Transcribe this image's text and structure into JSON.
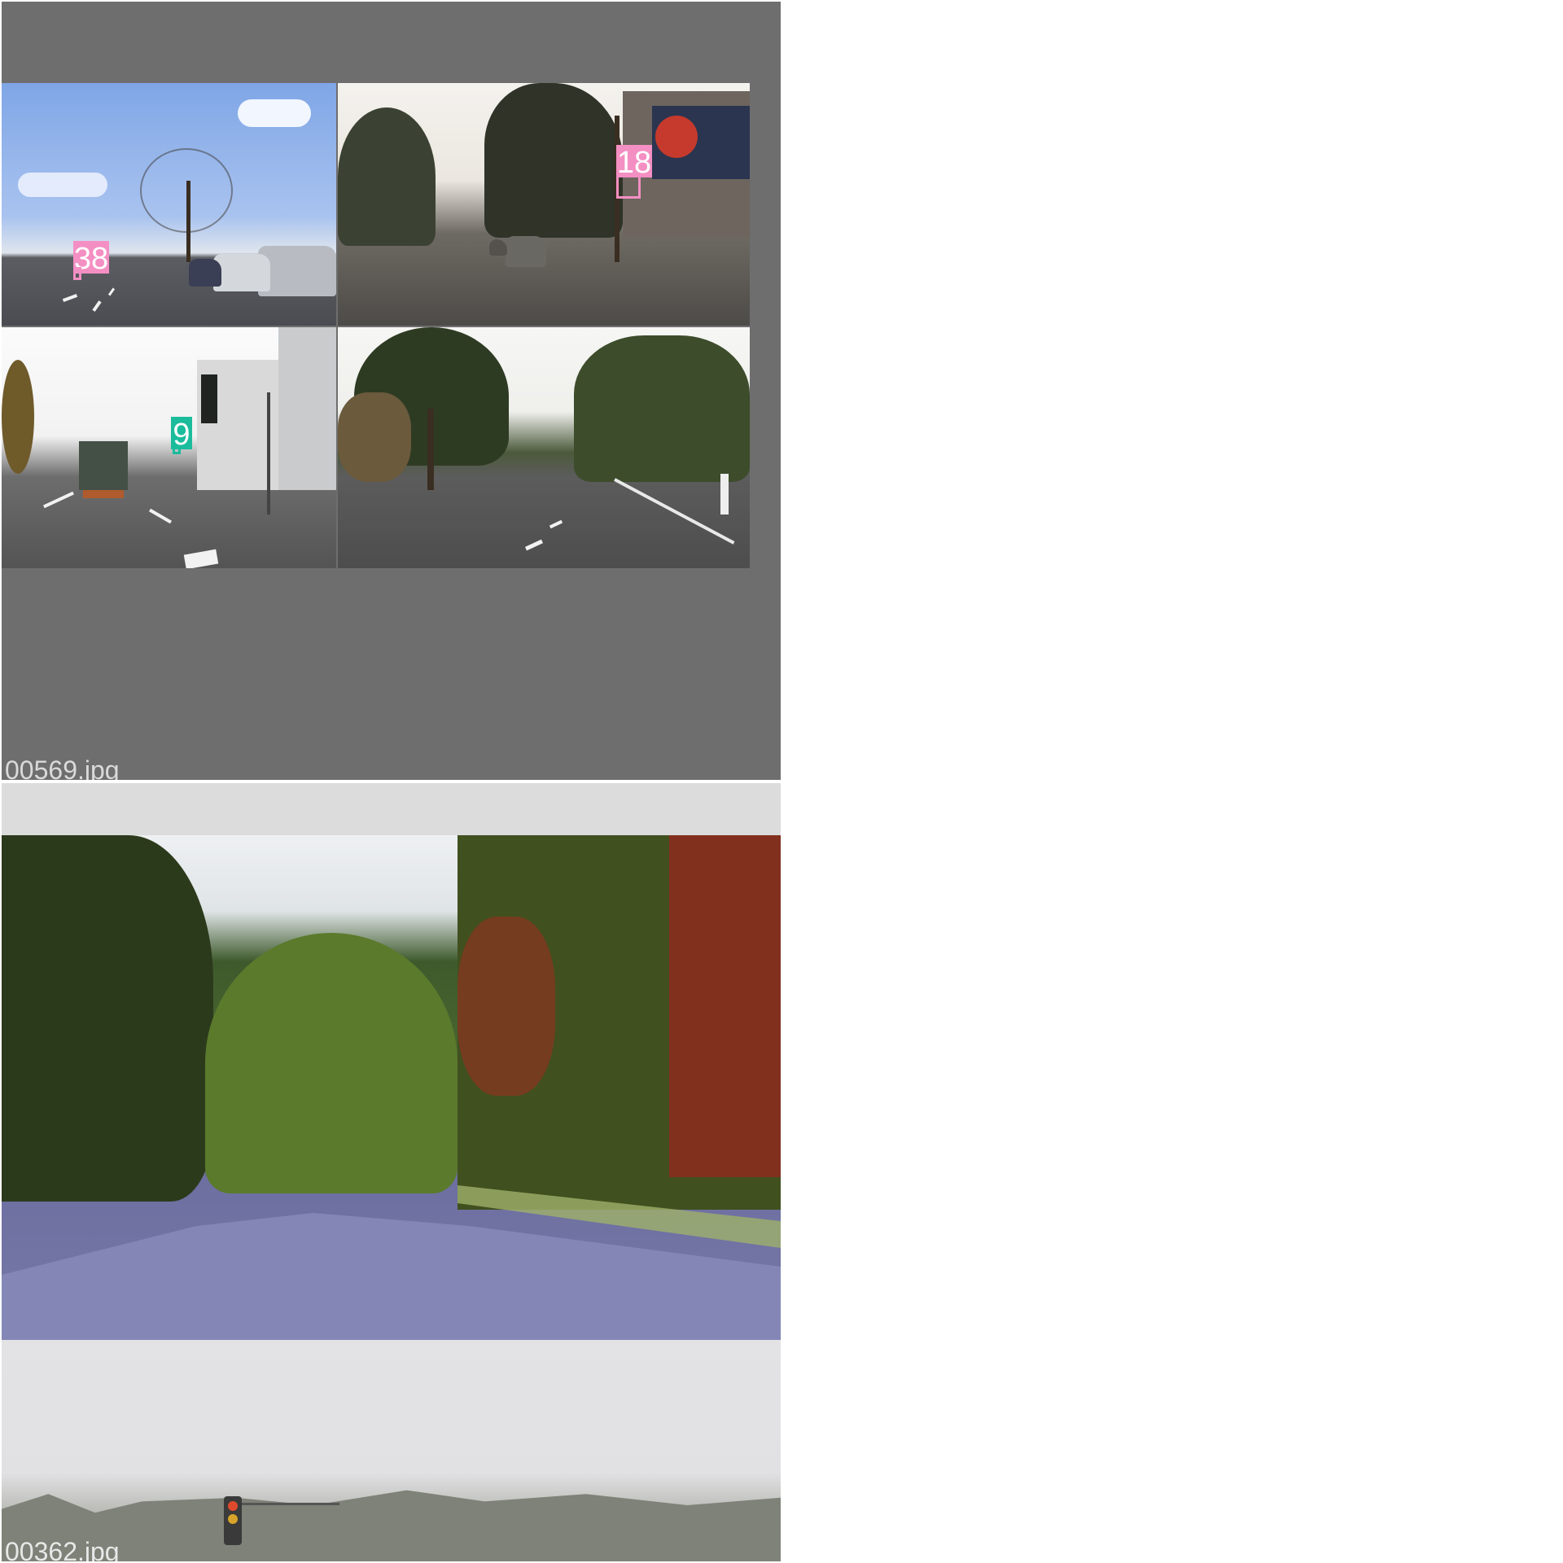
{
  "tiles": [
    {
      "filename": "00569.jpg",
      "background_color": "#6e6e6e",
      "mosaic_cells": [
        {
          "position": "top-left",
          "scene": "urban street with parked cars, bare tree, blue sky",
          "detections": [
            {
              "label": "38",
              "color": "#f48fc3"
            }
          ]
        },
        {
          "position": "top-right",
          "scene": "tree-lined avenue with cars and rental building sign",
          "detections": [
            {
              "label": "18",
              "color": "#f48fc3"
            }
          ]
        },
        {
          "position": "bottom-left",
          "scene": "street with truck, white houses and traffic light",
          "detections": [
            {
              "label": "9",
              "color": "#1abc9c"
            }
          ]
        },
        {
          "position": "bottom-right",
          "scene": "suburban road with trees and sidewalk",
          "detections": []
        }
      ]
    },
    {
      "filename": "00362.jpg",
      "background_color": "#dcdcdc",
      "scene": "curved road with autumn foliage; hazy sky with tree line and traffic light below"
    }
  ],
  "colors": {
    "pink_label": "#f48fc3",
    "teal_label": "#1abc9c"
  }
}
